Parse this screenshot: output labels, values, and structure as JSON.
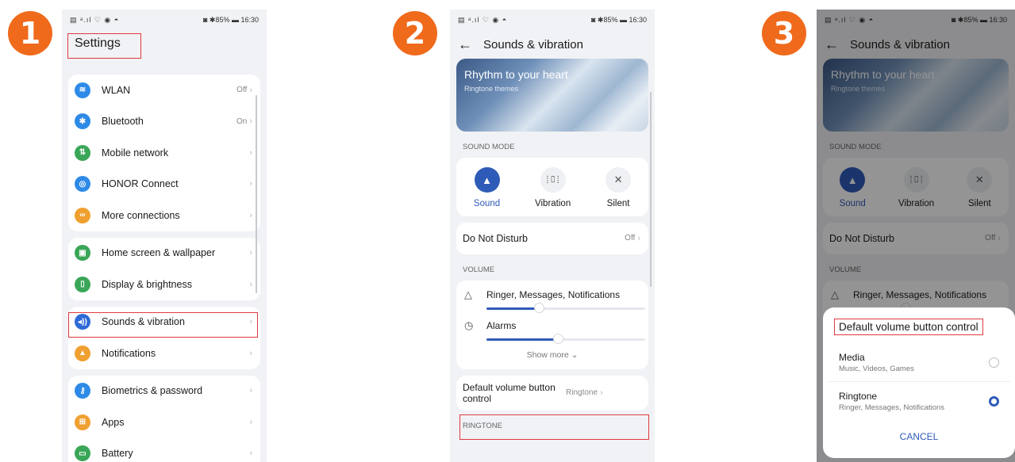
{
  "steps": [
    "1",
    "2",
    "3"
  ],
  "status": {
    "left": "▤ ᵊ.ıl ♡ ◉ ◓",
    "right": "◙ ✱85% ▬ 16:30"
  },
  "screen1": {
    "title": "Settings",
    "groups": [
      [
        {
          "label": "WLAN",
          "value": "Off",
          "icon": "wifi-icon",
          "color": "#2e8ae6",
          "glyph": "≋"
        },
        {
          "label": "Bluetooth",
          "value": "On",
          "icon": "bluetooth-icon",
          "color": "#2e8ae6",
          "glyph": "✱"
        },
        {
          "label": "Mobile network",
          "value": "",
          "icon": "mobile-network-icon",
          "color": "#3aa657",
          "glyph": "⇅"
        },
        {
          "label": "HONOR Connect",
          "value": "",
          "icon": "honor-connect-icon",
          "color": "#2e8ae6",
          "glyph": "◎"
        },
        {
          "label": "More connections",
          "value": "",
          "icon": "link-icon",
          "color": "#f0a030",
          "glyph": "∞"
        }
      ],
      [
        {
          "label": "Home screen & wallpaper",
          "value": "",
          "icon": "wallpaper-icon",
          "color": "#3aa657",
          "glyph": "▣"
        },
        {
          "label": "Display & brightness",
          "value": "",
          "icon": "display-icon",
          "color": "#3aa657",
          "glyph": "▯"
        }
      ],
      [
        {
          "label": "Sounds & vibration",
          "value": "",
          "icon": "sound-icon",
          "color": "#2e6ad6",
          "glyph": "◂))"
        },
        {
          "label": "Notifications",
          "value": "",
          "icon": "bell-icon",
          "color": "#f0a030",
          "glyph": "▲"
        }
      ],
      [
        {
          "label": "Biometrics & password",
          "value": "",
          "icon": "key-icon",
          "color": "#2e8ae6",
          "glyph": "⚷"
        },
        {
          "label": "Apps",
          "value": "",
          "icon": "apps-icon",
          "color": "#f0a030",
          "glyph": "⊞"
        },
        {
          "label": "Battery",
          "value": "",
          "icon": "battery-icon",
          "color": "#3aa657",
          "glyph": "▭"
        }
      ]
    ]
  },
  "screen2": {
    "title": "Sounds & vibration",
    "banner_title": "Rhythm to your heart",
    "banner_sub": "Ringtone themes",
    "sound_mode_header": "SOUND MODE",
    "modes": [
      {
        "label": "Sound",
        "icon": "bell-icon",
        "active": true
      },
      {
        "label": "Vibration",
        "icon": "vibration-icon",
        "active": false
      },
      {
        "label": "Silent",
        "icon": "bell-off-icon",
        "active": false
      }
    ],
    "dnd_label": "Do Not Disturb",
    "dnd_value": "Off",
    "volume_header": "VOLUME",
    "volumes": [
      {
        "label": "Ringer, Messages, Notifications",
        "icon": "bell-outline-icon",
        "level": 0.33
      },
      {
        "label": "Alarms",
        "icon": "alarm-icon",
        "level": 0.45
      }
    ],
    "show_more": "Show more",
    "default_btn_label": "Default volume button control",
    "default_btn_value": "Ringtone",
    "next_header": "RINGTONE"
  },
  "screen3": {
    "dialog_title": "Default volume button control",
    "options": [
      {
        "name": "Media",
        "sub": "Music, Videos, Games",
        "selected": false
      },
      {
        "name": "Ringtone",
        "sub": "Ringer, Messages, Notifications",
        "selected": true
      }
    ],
    "cancel": "CANCEL"
  }
}
